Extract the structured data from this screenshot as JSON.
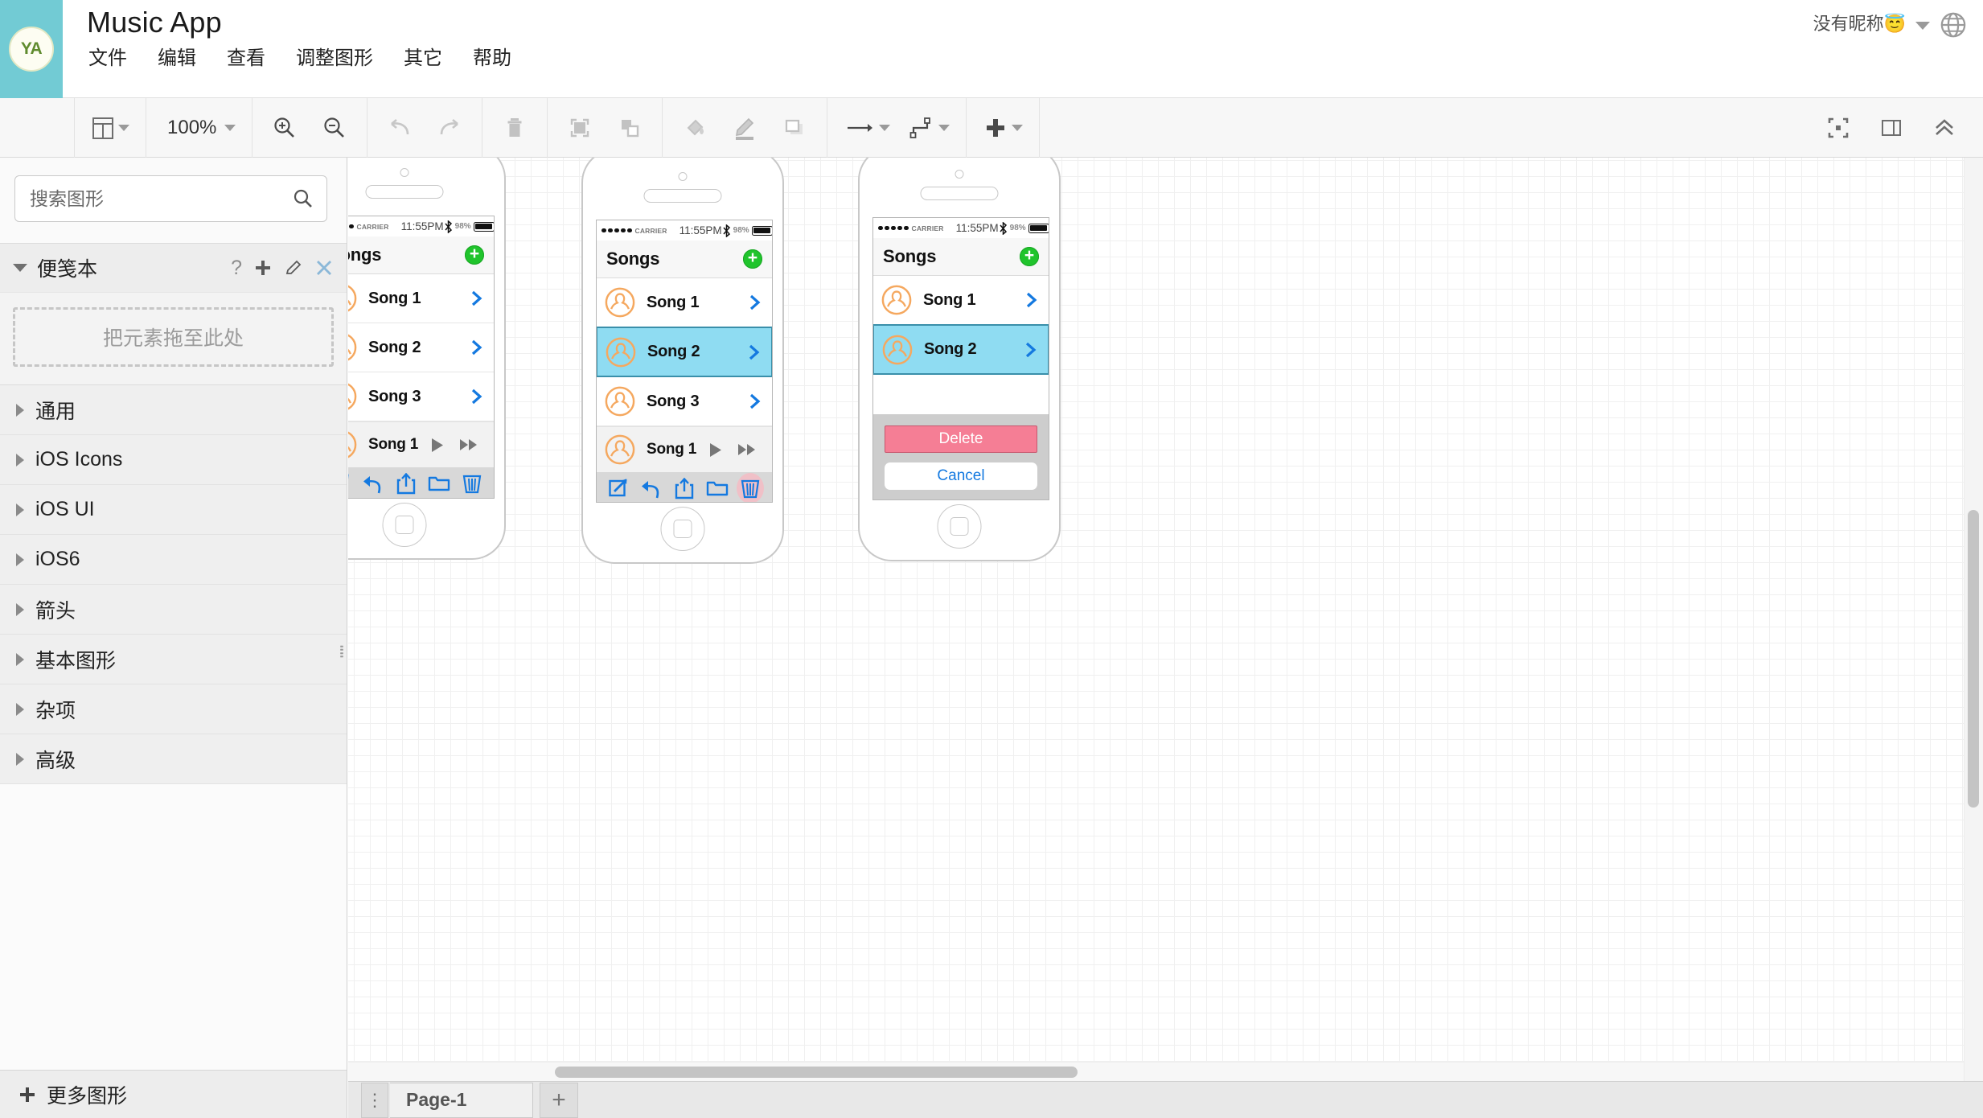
{
  "header": {
    "logo_text": "YA",
    "app_title": "Music App",
    "menus": [
      "文件",
      "编辑",
      "查看",
      "调整图形",
      "其它",
      "帮助"
    ],
    "user_name": "没有昵称😇",
    "globe_icon": "globe-icon",
    "caret_icon": "chevron-down-icon"
  },
  "toolbar": {
    "layout_icon": "layout-panel-icon",
    "zoom_level": "100%",
    "zoom_in_icon": "zoom-in-icon",
    "zoom_out_icon": "zoom-out-icon",
    "undo_icon": "undo-icon",
    "redo_icon": "redo-icon",
    "delete_icon": "trash-icon",
    "to_front_icon": "bring-to-front-icon",
    "to_back_icon": "send-to-back-icon",
    "fill_icon": "fill-color-icon",
    "line_icon": "line-color-icon",
    "shadow_icon": "shadow-icon",
    "arrow_icon": "arrow-style-icon",
    "waypoint_icon": "waypoint-style-icon",
    "insert_icon": "insert-plus-icon",
    "fullscreen_icon": "fit-page-icon",
    "format_panel_icon": "format-panel-icon",
    "collapse_icon": "collapse-chevron-icon"
  },
  "sidebar": {
    "search_placeholder": "搜索图形",
    "search_value": "",
    "search_icon": "search-icon",
    "scratchpad": {
      "title": "便笺本",
      "help_icon": "?",
      "add_icon": "plus-icon",
      "edit_icon": "pencil-icon",
      "close_icon": "close-icon",
      "dropzone_text": "把元素拖至此处"
    },
    "categories": [
      "通用",
      "iOS Icons",
      "iOS UI",
      "iOS6",
      "箭头",
      "基本图形",
      "杂项",
      "高级"
    ],
    "more_shapes": "更多图形",
    "more_shapes_icon": "plus-icon"
  },
  "pagebar": {
    "menu_icon": "page-menu-icon",
    "page_name": "Page-1",
    "add_icon": "add-page-icon"
  },
  "statusbar": {
    "carrier": "CARRIER",
    "time": "11:55PM",
    "battery_pct": "98%",
    "wifi_icon": "wifi-icon",
    "bluetooth_icon": "bluetooth-icon",
    "battery_icon": "battery-icon"
  },
  "colors": {
    "accent_blue": "#1479e0",
    "avatar_orange": "#f5a85f",
    "green_add": "#20c42c",
    "selected_blue": "#8fdcf2",
    "selected_border": "#3a8faa",
    "delete_pink": "#f57e95",
    "logo_teal": "#72cbd4"
  },
  "phones": [
    {
      "nav_title": "Songs",
      "add_button_icon": "plus-circle-icon",
      "rows": [
        {
          "name": "Song 1",
          "selected": false
        },
        {
          "name": "Song 2",
          "selected": false
        },
        {
          "name": "Song 3",
          "selected": false
        }
      ],
      "player": {
        "name": "Song 1",
        "play_icon": "play-icon",
        "forward_icon": "fast-forward-icon"
      },
      "tabs": [
        {
          "icon": "compose-icon",
          "highlighted": false
        },
        {
          "icon": "reply-icon",
          "highlighted": false
        },
        {
          "icon": "share-icon",
          "highlighted": false
        },
        {
          "icon": "folder-icon",
          "highlighted": false
        },
        {
          "icon": "trash-icon",
          "highlighted": false
        }
      ],
      "action_sheet": null
    },
    {
      "nav_title": "Songs",
      "add_button_icon": "plus-circle-icon",
      "rows": [
        {
          "name": "Song 1",
          "selected": false
        },
        {
          "name": "Song 2",
          "selected": true
        },
        {
          "name": "Song 3",
          "selected": false
        }
      ],
      "player": {
        "name": "Song 1",
        "play_icon": "play-icon",
        "forward_icon": "fast-forward-icon"
      },
      "tabs": [
        {
          "icon": "compose-icon",
          "highlighted": false
        },
        {
          "icon": "reply-icon",
          "highlighted": false
        },
        {
          "icon": "share-icon",
          "highlighted": false
        },
        {
          "icon": "folder-icon",
          "highlighted": false
        },
        {
          "icon": "trash-icon",
          "highlighted": true
        }
      ],
      "action_sheet": null
    },
    {
      "nav_title": "Songs",
      "add_button_icon": "plus-circle-icon",
      "rows": [
        {
          "name": "Song 1",
          "selected": false
        },
        {
          "name": "Song 2",
          "selected": true
        }
      ],
      "player": null,
      "tabs": null,
      "action_sheet": {
        "delete_label": "Delete",
        "cancel_label": "Cancel"
      }
    }
  ]
}
